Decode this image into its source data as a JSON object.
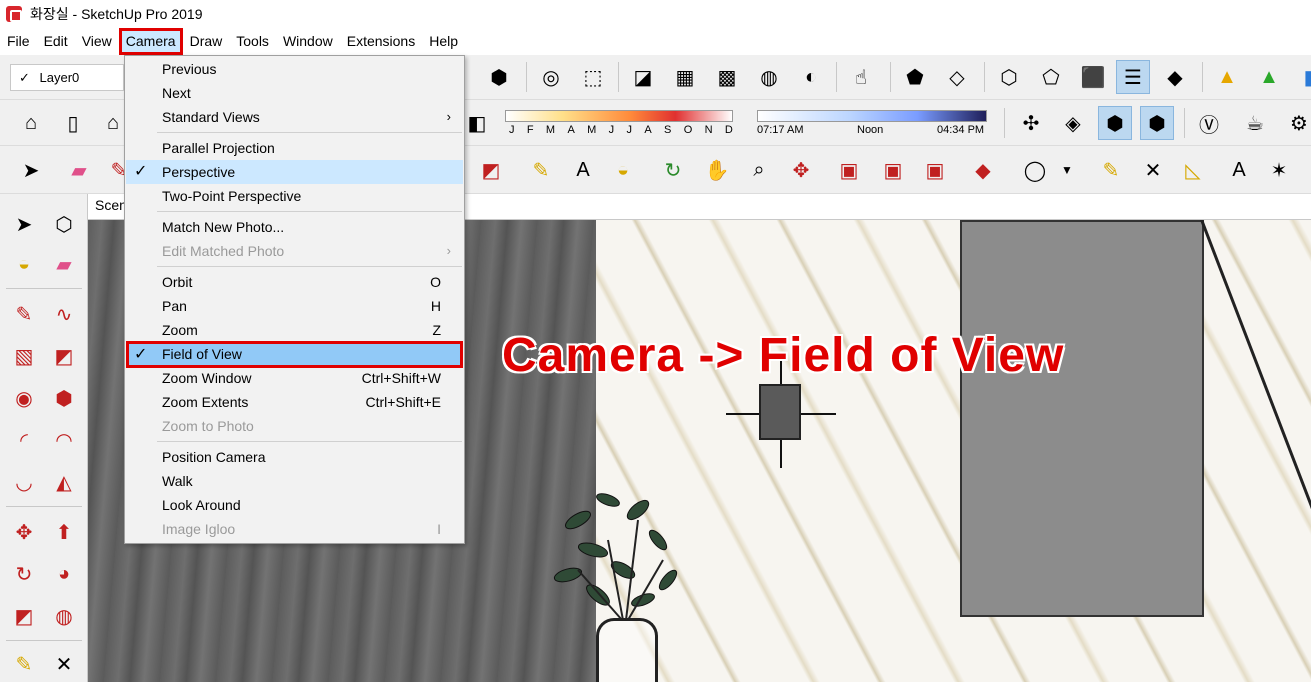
{
  "window": {
    "title": "화장실 - SketchUp Pro 2019"
  },
  "menubar": {
    "items": [
      "File",
      "Edit",
      "View",
      "Camera",
      "Draw",
      "Tools",
      "Window",
      "Extensions",
      "Help"
    ]
  },
  "layer": {
    "check": "✓",
    "name": "Layer0"
  },
  "shadows": {
    "months": [
      "J",
      "F",
      "M",
      "A",
      "M",
      "J",
      "J",
      "A",
      "S",
      "O",
      "N",
      "D"
    ],
    "time_start": "07:17 AM",
    "time_mid": "Noon",
    "time_end": "04:34 PM"
  },
  "scene_tab": {
    "label": "Scen"
  },
  "camera_menu": {
    "items": [
      {
        "label": "Previous"
      },
      {
        "label": "Next"
      },
      {
        "label": "Standard Views",
        "arrow": "›"
      },
      {
        "label": "Parallel Projection"
      },
      {
        "label": "Perspective",
        "check": "✓"
      },
      {
        "label": "Two-Point Perspective"
      },
      {
        "label": "Match New Photo..."
      },
      {
        "label": "Edit Matched Photo",
        "arrow": "›"
      },
      {
        "label": "Orbit",
        "shortcut": "O"
      },
      {
        "label": "Pan",
        "shortcut": "H"
      },
      {
        "label": "Zoom",
        "shortcut": "Z"
      },
      {
        "label": "Field of View",
        "check": "✓"
      },
      {
        "label": "Zoom Window",
        "shortcut": "Ctrl+Shift+W"
      },
      {
        "label": "Zoom Extents",
        "shortcut": "Ctrl+Shift+E"
      },
      {
        "label": "Zoom to Photo"
      },
      {
        "label": "Position Camera"
      },
      {
        "label": "Walk"
      },
      {
        "label": "Look Around"
      },
      {
        "label": "Image Igloo",
        "shortcut": "I"
      }
    ]
  },
  "annotation": {
    "text": "Camera -> Field of View"
  },
  "colors": {
    "highlight_outline": "#e00000",
    "menu_highlight": "#91c9f7"
  }
}
